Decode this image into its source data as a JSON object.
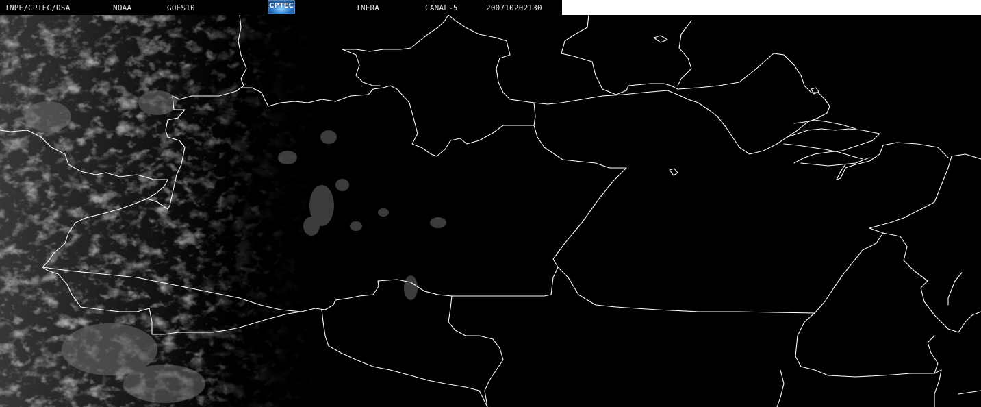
{
  "header": {
    "source": "INPE/CPTEC/DSA",
    "agency": "NOAA",
    "satellite": "GOES10",
    "logo_text": "CPTEC",
    "product": "INFRA",
    "channel": "CANAL-5",
    "timestamp": "200710202130"
  },
  "colors": {
    "background": "#000000",
    "header_text": "#e6e6e6",
    "border_lines": "#ffffff",
    "cloud_gray": "#8a8a8a",
    "header_right_blank": "#ffffff"
  },
  "icons": {
    "logo": "cptec-logo"
  }
}
